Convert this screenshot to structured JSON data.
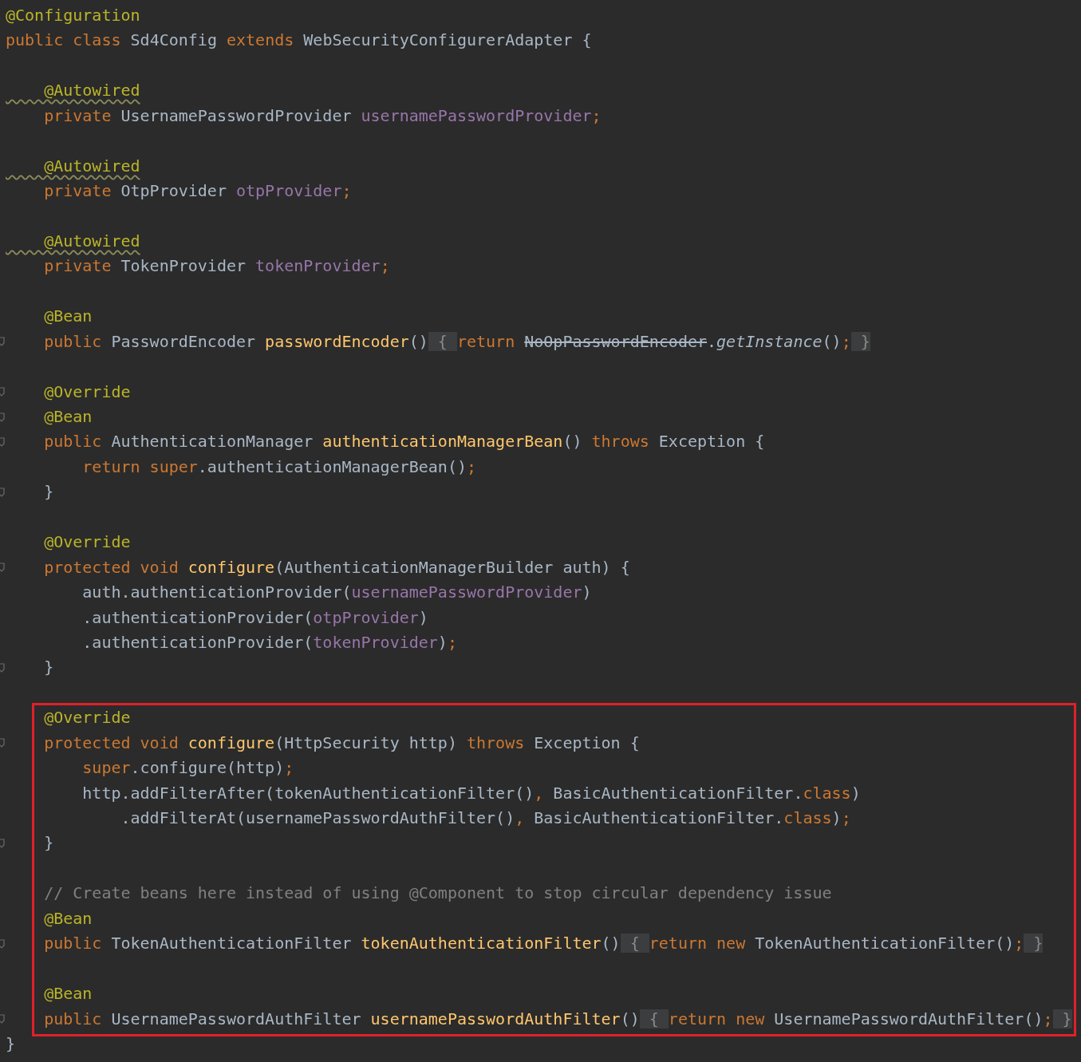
{
  "sections": [
    {
      "highlighted": false,
      "lines": [
        {
          "fold": false,
          "tokens": [
            {
              "t": "@Configuration",
              "kind": "ann"
            }
          ]
        },
        {
          "fold": false,
          "tokens": [
            {
              "t": "public class ",
              "kind": "kw"
            },
            {
              "t": "Sd4Config ",
              "kind": "plain"
            },
            {
              "t": "extends ",
              "kind": "kw"
            },
            {
              "t": "WebSecurityConfigurerAdapter {",
              "kind": "plain"
            }
          ]
        },
        {
          "fold": false
        },
        {
          "fold": false,
          "tokens": [
            {
              "t": "    @Autowired",
              "kind": "warn"
            }
          ]
        },
        {
          "fold": false,
          "tokens": [
            {
              "t": "    private ",
              "kind": "kw"
            },
            {
              "t": "UsernamePasswordProvider ",
              "kind": "plain"
            },
            {
              "t": "usernamePasswordProvider",
              "kind": "field"
            },
            {
              "t": ";",
              "kind": "kw"
            }
          ]
        },
        {
          "fold": false
        },
        {
          "fold": false,
          "tokens": [
            {
              "t": "    @Autowired",
              "kind": "warn"
            }
          ]
        },
        {
          "fold": false,
          "tokens": [
            {
              "t": "    private ",
              "kind": "kw"
            },
            {
              "t": "OtpProvider ",
              "kind": "plain"
            },
            {
              "t": "otpProvider",
              "kind": "field"
            },
            {
              "t": ";",
              "kind": "kw"
            }
          ]
        },
        {
          "fold": false
        },
        {
          "fold": false,
          "tokens": [
            {
              "t": "    @Autowired",
              "kind": "warn"
            }
          ]
        },
        {
          "fold": false,
          "tokens": [
            {
              "t": "    private ",
              "kind": "kw"
            },
            {
              "t": "TokenProvider ",
              "kind": "plain"
            },
            {
              "t": "tokenProvider",
              "kind": "field"
            },
            {
              "t": ";",
              "kind": "kw"
            }
          ]
        },
        {
          "fold": false
        },
        {
          "fold": false,
          "tokens": [
            {
              "t": "    @Bean",
              "kind": "ann"
            }
          ]
        },
        {
          "fold": true,
          "tokens": [
            {
              "t": "    public ",
              "kind": "kw"
            },
            {
              "t": "PasswordEncoder ",
              "kind": "plain"
            },
            {
              "t": "passwordEncoder",
              "kind": "method"
            },
            {
              "t": "()",
              "kind": "plain"
            },
            {
              "t": " { ",
              "kind": "folded"
            },
            {
              "t": "return ",
              "kind": "kw"
            },
            {
              "t": "NoOpPasswordEncoder",
              "kind": "strike"
            },
            {
              "t": ".",
              "kind": "plain"
            },
            {
              "t": "getInstance",
              "kind": "italic"
            },
            {
              "t": "()",
              "kind": "plain"
            },
            {
              "t": ";",
              "kind": "kw"
            },
            {
              "t": " }",
              "kind": "folded"
            }
          ]
        },
        {
          "fold": false
        },
        {
          "fold": true,
          "tokens": [
            {
              "t": "    @Override",
              "kind": "ann"
            }
          ]
        },
        {
          "fold": true,
          "tokens": [
            {
              "t": "    @Bean",
              "kind": "ann"
            }
          ]
        },
        {
          "fold": true,
          "tokens": [
            {
              "t": "    public ",
              "kind": "kw"
            },
            {
              "t": "AuthenticationManager ",
              "kind": "plain"
            },
            {
              "t": "authenticationManagerBean",
              "kind": "method"
            },
            {
              "t": "() ",
              "kind": "plain"
            },
            {
              "t": "throws ",
              "kind": "kw"
            },
            {
              "t": "Exception {",
              "kind": "plain"
            }
          ]
        },
        {
          "fold": false,
          "tokens": [
            {
              "t": "        return super",
              "kind": "kw"
            },
            {
              "t": ".authenticationManagerBean()",
              "kind": "plain"
            },
            {
              "t": ";",
              "kind": "kw"
            }
          ]
        },
        {
          "fold": true,
          "tokens": [
            {
              "t": "    }",
              "kind": "plain"
            }
          ]
        },
        {
          "fold": false
        },
        {
          "fold": false,
          "tokens": [
            {
              "t": "    @Override",
              "kind": "ann"
            }
          ]
        },
        {
          "fold": true,
          "tokens": [
            {
              "t": "    protected void ",
              "kind": "kw"
            },
            {
              "t": "configure",
              "kind": "method"
            },
            {
              "t": "(AuthenticationManagerBuilder auth) {",
              "kind": "plain"
            }
          ]
        },
        {
          "fold": false,
          "tokens": [
            {
              "t": "        auth.authenticationProvider(",
              "kind": "plain"
            },
            {
              "t": "usernamePasswordProvider",
              "kind": "field"
            },
            {
              "t": ")",
              "kind": "plain"
            }
          ]
        },
        {
          "fold": false,
          "tokens": [
            {
              "t": "        .authenticationProvider(",
              "kind": "plain"
            },
            {
              "t": "otpProvider",
              "kind": "field"
            },
            {
              "t": ")",
              "kind": "plain"
            }
          ]
        },
        {
          "fold": false,
          "tokens": [
            {
              "t": "        .authenticationProvider(",
              "kind": "plain"
            },
            {
              "t": "tokenProvider",
              "kind": "field"
            },
            {
              "t": ")",
              "kind": "plain"
            },
            {
              "t": ";",
              "kind": "kw"
            }
          ]
        },
        {
          "fold": true,
          "tokens": [
            {
              "t": "    }",
              "kind": "plain"
            }
          ]
        },
        {
          "fold": false
        }
      ]
    },
    {
      "highlighted": true,
      "lines": [
        {
          "fold": false,
          "tokens": [
            {
              "t": "    @Override",
              "kind": "ann"
            }
          ]
        },
        {
          "fold": true,
          "tokens": [
            {
              "t": "    protected void ",
              "kind": "kw"
            },
            {
              "t": "configure",
              "kind": "method"
            },
            {
              "t": "(HttpSecurity http) ",
              "kind": "plain"
            },
            {
              "t": "throws ",
              "kind": "kw"
            },
            {
              "t": "Exception {",
              "kind": "plain"
            }
          ]
        },
        {
          "fold": false,
          "tokens": [
            {
              "t": "        super",
              "kind": "kw"
            },
            {
              "t": ".configure(http)",
              "kind": "plain"
            },
            {
              "t": ";",
              "kind": "kw"
            }
          ]
        },
        {
          "fold": false,
          "tokens": [
            {
              "t": "        http.addFilterAfter(tokenAuthenticationFilter()",
              "kind": "plain"
            },
            {
              "t": ", ",
              "kind": "kw"
            },
            {
              "t": "BasicAuthenticationFilter.",
              "kind": "plain"
            },
            {
              "t": "class",
              "kind": "kw"
            },
            {
              "t": ")",
              "kind": "plain"
            }
          ]
        },
        {
          "fold": false,
          "tokens": [
            {
              "t": "            .addFilterAt(usernamePasswordAuthFilter()",
              "kind": "plain"
            },
            {
              "t": ", ",
              "kind": "kw"
            },
            {
              "t": "BasicAuthenticationFilter.",
              "kind": "plain"
            },
            {
              "t": "class",
              "kind": "kw"
            },
            {
              "t": ")",
              "kind": "plain"
            },
            {
              "t": ";",
              "kind": "kw"
            }
          ]
        },
        {
          "fold": true,
          "tokens": [
            {
              "t": "    }",
              "kind": "plain"
            }
          ]
        },
        {
          "fold": false
        },
        {
          "fold": false,
          "tokens": [
            {
              "t": "    // Create beans here instead of using @Component to stop circular dependency issue",
              "kind": "comment"
            }
          ]
        },
        {
          "fold": false,
          "tokens": [
            {
              "t": "    @Bean",
              "kind": "ann"
            }
          ]
        },
        {
          "fold": true,
          "tokens": [
            {
              "t": "    public ",
              "kind": "kw"
            },
            {
              "t": "TokenAuthenticationFilter ",
              "kind": "plain"
            },
            {
              "t": "tokenAuthenticationFilter",
              "kind": "method"
            },
            {
              "t": "()",
              "kind": "plain"
            },
            {
              "t": " { ",
              "kind": "folded"
            },
            {
              "t": "return new ",
              "kind": "kw"
            },
            {
              "t": "TokenAuthenticationFilter()",
              "kind": "plain"
            },
            {
              "t": ";",
              "kind": "kw"
            },
            {
              "t": " }",
              "kind": "folded"
            }
          ]
        },
        {
          "fold": false
        },
        {
          "fold": false,
          "tokens": [
            {
              "t": "    @Bean",
              "kind": "ann"
            }
          ]
        },
        {
          "fold": true,
          "tokens": [
            {
              "t": "    public ",
              "kind": "kw"
            },
            {
              "t": "UsernamePasswordAuthFilter ",
              "kind": "plain"
            },
            {
              "t": "usernamePasswordAuthFilter",
              "kind": "method"
            },
            {
              "t": "()",
              "kind": "plain"
            },
            {
              "t": " { ",
              "kind": "folded"
            },
            {
              "t": "return new ",
              "kind": "kw"
            },
            {
              "t": "UsernamePasswordAuthFilter()",
              "kind": "plain"
            },
            {
              "t": ";",
              "kind": "kw"
            },
            {
              "t": " }",
              "kind": "folded"
            }
          ]
        }
      ]
    },
    {
      "highlighted": false,
      "lines": [
        {
          "fold": false,
          "tokens": [
            {
              "t": "}",
              "kind": "plain"
            }
          ]
        }
      ]
    }
  ]
}
